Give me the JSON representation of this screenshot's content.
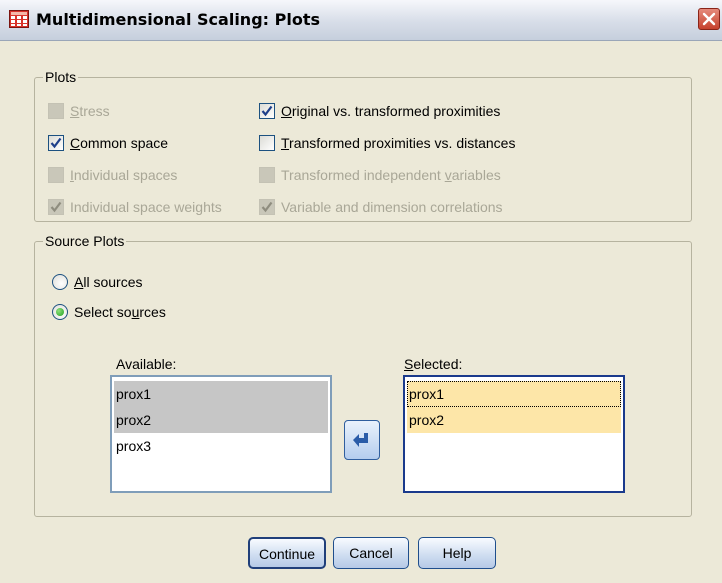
{
  "window": {
    "title": "Multidimensional Scaling: Plots"
  },
  "plots_group": {
    "legend": "Plots",
    "left_options": [
      {
        "label": "Stress",
        "checked": false,
        "disabled": true
      },
      {
        "label": "Common space",
        "checked": true,
        "disabled": false
      },
      {
        "label": "Individual spaces",
        "checked": false,
        "disabled": true
      },
      {
        "label": "Individual space weights",
        "checked": true,
        "disabled": true
      }
    ],
    "right_options": [
      {
        "label": "Original vs. transformed proximities",
        "checked": true,
        "disabled": false
      },
      {
        "label": "Transformed proximities vs. distances",
        "checked": false,
        "disabled": false
      },
      {
        "label": "Transformed independent variables",
        "checked": false,
        "disabled": true
      },
      {
        "label": "Variable and dimension correlations",
        "checked": true,
        "disabled": true
      }
    ]
  },
  "source_group": {
    "legend": "Source Plots",
    "radios": [
      {
        "label": "All sources",
        "selected": false
      },
      {
        "label": "Select sources",
        "selected": true
      }
    ],
    "available": {
      "label": "Available:",
      "items": [
        "prox1",
        "prox2",
        "prox3"
      ]
    },
    "selected": {
      "label": "Selected:",
      "items": [
        "prox1",
        "prox2"
      ]
    }
  },
  "buttons": {
    "continue": "Continue",
    "cancel": "Cancel",
    "help": "Help"
  },
  "icons": {
    "app": "grid-icon",
    "close": "close-icon",
    "move": "arrow-left-icon"
  },
  "colors": {
    "selection_yellow": "#fde6a8",
    "selection_grey": "#c6c6c6",
    "face": "#ece9d8"
  }
}
